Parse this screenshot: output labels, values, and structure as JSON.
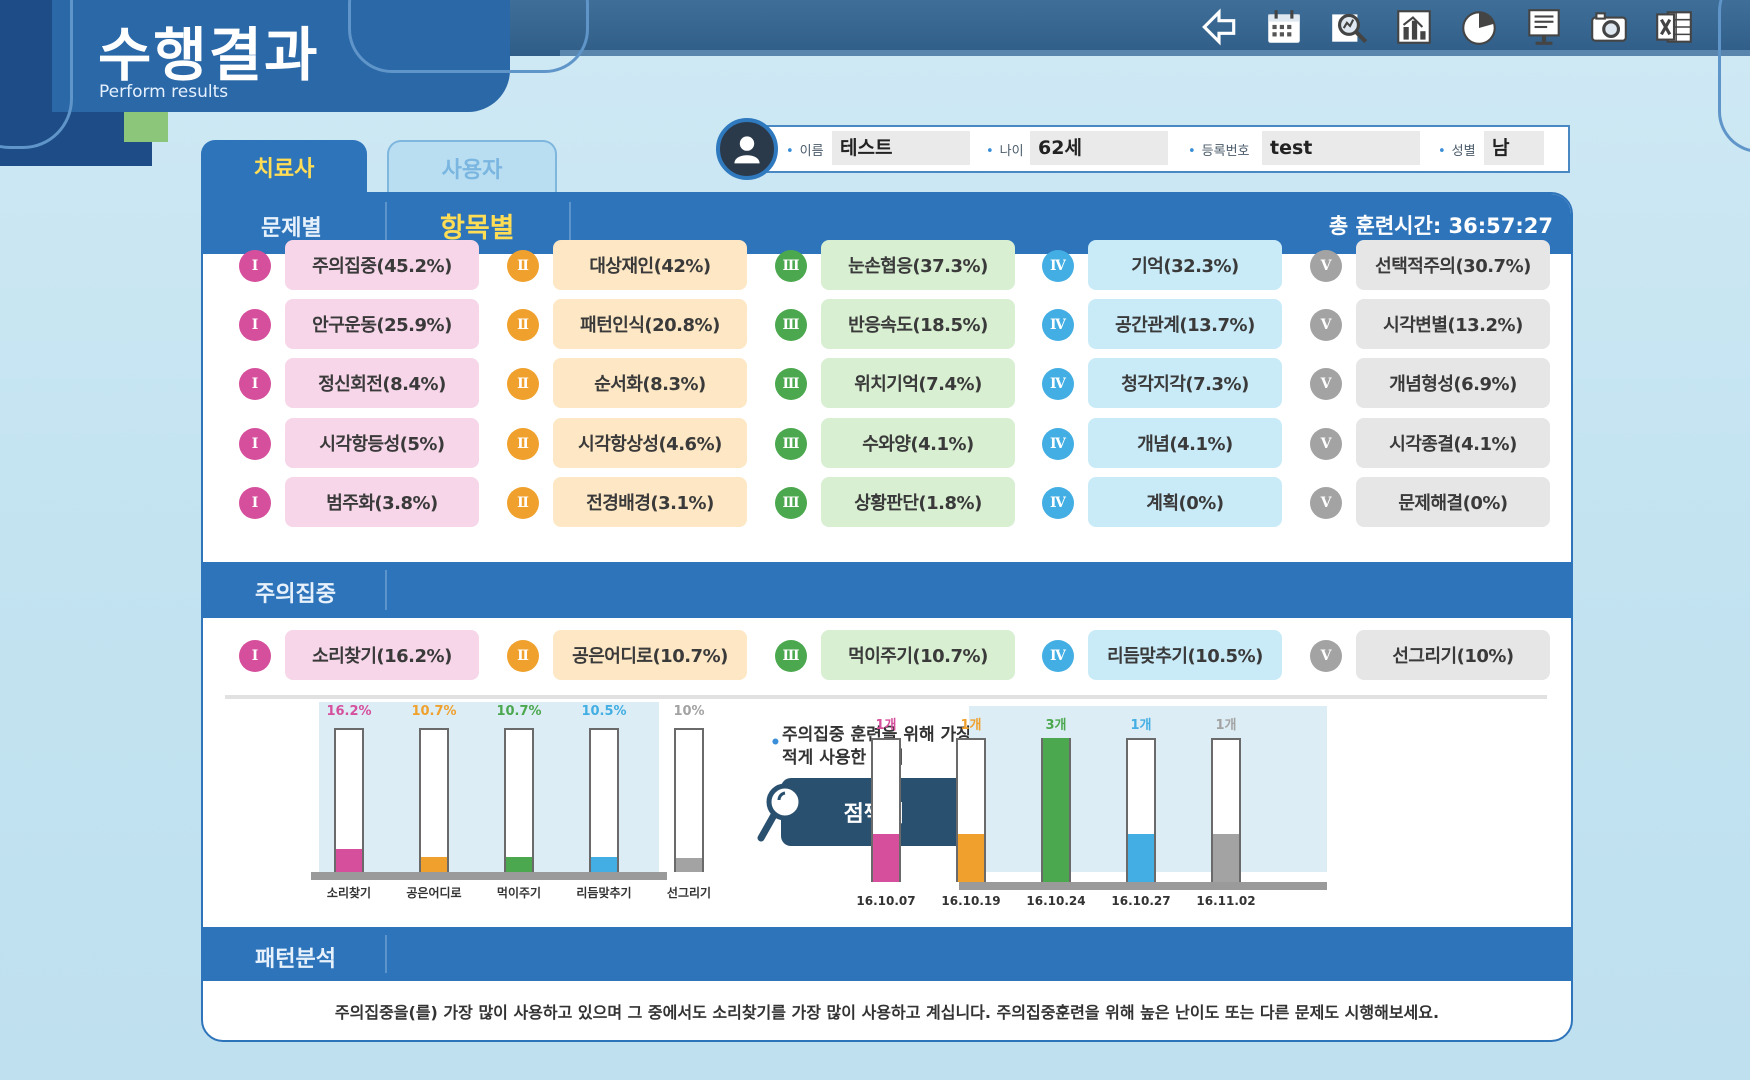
{
  "header": {
    "title": "수행결과",
    "subtitle": "Perform results",
    "toolbar": [
      "back-icon",
      "calendar-icon",
      "search-report-icon",
      "bar-chart-icon",
      "pie-chart-icon",
      "monitor-icon",
      "camera-icon",
      "excel-icon"
    ]
  },
  "tabs": {
    "therapist": "치료사",
    "user": "사용자"
  },
  "patient": {
    "name_label": "이름",
    "name": "테스트",
    "age_label": "나이",
    "age": "62세",
    "reg_label": "등록번호",
    "reg": "test",
    "sex_label": "성별",
    "sex": "남"
  },
  "subtabs": {
    "by_problem": "문제별",
    "by_item": "항목별"
  },
  "total_time": "총 훈련시간: 36:57:27",
  "categories": {
    "numerals": [
      "Ⅰ",
      "Ⅱ",
      "Ⅲ",
      "Ⅳ",
      "Ⅴ"
    ],
    "rows": [
      [
        "주의집중(45.2%)",
        "대상재인(42%)",
        "눈손협응(37.3%)",
        "기억(32.3%)",
        "선택적주의(30.7%)"
      ],
      [
        "안구운동(25.9%)",
        "패턴인식(20.8%)",
        "반응속도(18.5%)",
        "공간관계(13.7%)",
        "시각변별(13.2%)"
      ],
      [
        "정신회전(8.4%)",
        "순서화(8.3%)",
        "위치기억(7.4%)",
        "청각지각(7.3%)",
        "개념형성(6.9%)"
      ],
      [
        "시각항등성(5%)",
        "시각항상성(4.6%)",
        "수와양(4.1%)",
        "개념(4.1%)",
        "시각종결(4.1%)"
      ],
      [
        "범주화(3.8%)",
        "전경배경(3.1%)",
        "상황판단(1.8%)",
        "계획(0%)",
        "문제해결(0%)"
      ]
    ]
  },
  "focus": {
    "title": "주의집중",
    "items": [
      "소리찾기(16.2%)",
      "공은어디로(10.7%)",
      "먹이주기(10.7%)",
      "리듬맞추기(10.5%)",
      "선그리기(10%)"
    ]
  },
  "callout": {
    "line1": "주의집중 훈련을 위해 가장",
    "line2": "적게 사용한 문제",
    "least_used": "점찍기"
  },
  "pattern": {
    "title": "패턴분석",
    "text": "주의집중을(를) 가장 많이 사용하고 있으며 그 중에서도 소리찾기를 가장 많이 사용하고 계십니다. 주의집중훈련을 위해 높은 난이도 또는 다른 문제도 시행해보세요."
  },
  "colors": {
    "c1": "#d64f9d",
    "c2": "#f0a12d",
    "c3": "#4ba84e",
    "c4": "#43aee3",
    "c5": "#a3a3a3",
    "band": "#2e74bb"
  },
  "chart_data": [
    {
      "type": "bar",
      "categories": [
        "소리찾기",
        "공은어디로",
        "먹이주기",
        "리듬맞추기",
        "선그리기"
      ],
      "labels": [
        "16.2%",
        "10.7%",
        "10.7%",
        "10.5%",
        "10%"
      ],
      "values": [
        16.2,
        10.7,
        10.7,
        10.5,
        10
      ],
      "ylim": [
        0,
        100
      ]
    },
    {
      "type": "bar",
      "categories": [
        "16.10.07",
        "16.10.19",
        "16.10.24",
        "16.10.27",
        "16.11.02"
      ],
      "labels": [
        "1개",
        "1개",
        "3개",
        "1개",
        "1개"
      ],
      "values": [
        1,
        1,
        3,
        1,
        1
      ],
      "ylim": [
        0,
        3
      ]
    }
  ]
}
